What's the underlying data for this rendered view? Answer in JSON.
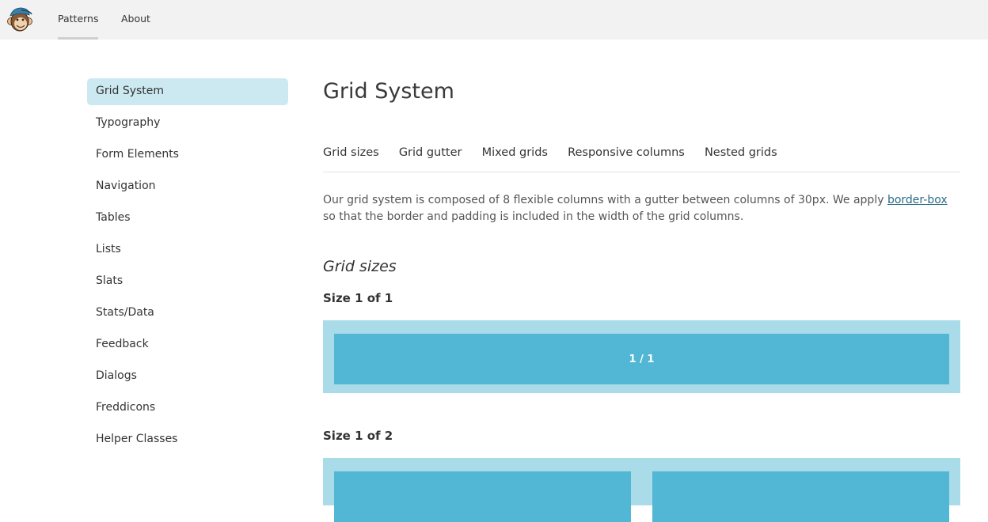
{
  "topbar": {
    "logo_icon": "monkey-logo-icon",
    "nav": [
      {
        "label": "Patterns",
        "active": true
      },
      {
        "label": "About",
        "active": false
      }
    ]
  },
  "sidebar": {
    "items": [
      {
        "label": "Grid System",
        "active": true
      },
      {
        "label": "Typography"
      },
      {
        "label": "Form Elements"
      },
      {
        "label": "Navigation"
      },
      {
        "label": "Tables"
      },
      {
        "label": "Lists"
      },
      {
        "label": "Slats"
      },
      {
        "label": "Stats/Data"
      },
      {
        "label": "Feedback"
      },
      {
        "label": "Dialogs"
      },
      {
        "label": "Freddicons"
      },
      {
        "label": "Helper Classes"
      }
    ]
  },
  "main": {
    "title": "Grid System",
    "subnav": [
      "Grid sizes",
      "Grid gutter",
      "Mixed grids",
      "Responsive columns",
      "Nested grids"
    ],
    "intro": {
      "before": "Our grid system is composed of 8 flexible columns with a gutter between columns of 30px. We apply ",
      "link": "border-box",
      "after": " so that the border and padding is included in the width of the grid columns."
    },
    "section_title": "Grid sizes",
    "sizes": [
      {
        "label": "Size 1 of 1",
        "cells": [
          "1 / 1"
        ]
      },
      {
        "label": "Size 1 of 2",
        "cells": [
          "",
          ""
        ]
      }
    ]
  },
  "colors": {
    "topbar_bg": "#f2f2f2",
    "sidebar_active_bg": "#cce9f1",
    "grid_outer": "#a9dbe8",
    "grid_cell": "#52b7d5",
    "link": "#2b6b86"
  }
}
